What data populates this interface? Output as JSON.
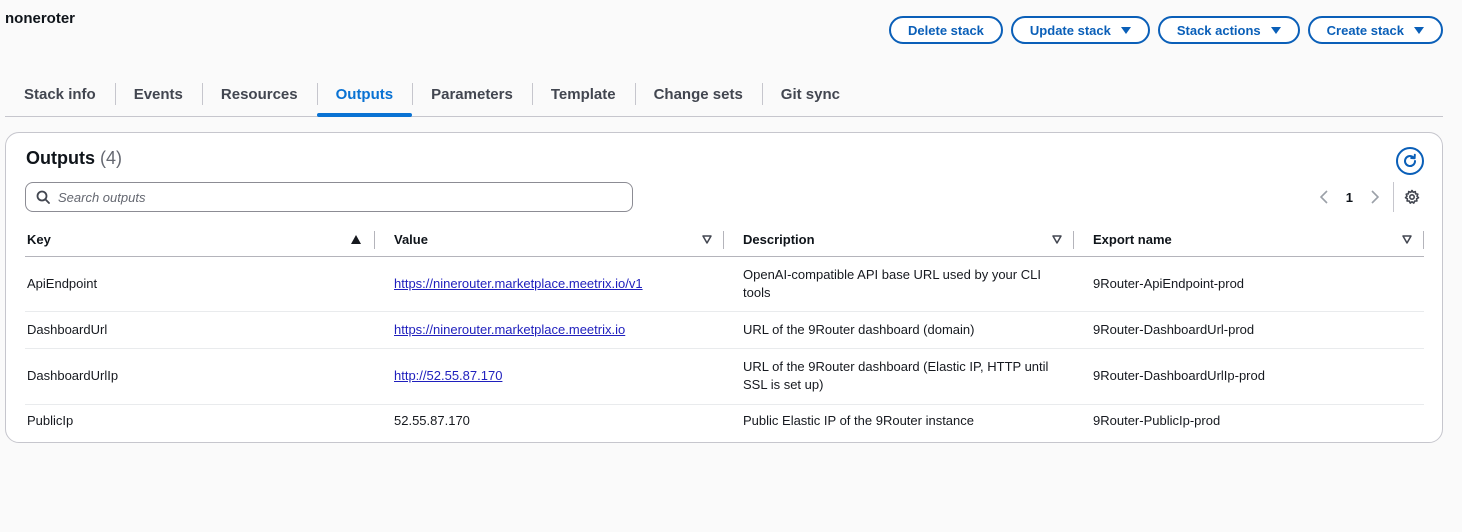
{
  "stack": {
    "title": "noneroter"
  },
  "actions": {
    "delete": "Delete stack",
    "update": "Update stack",
    "stack_actions": "Stack actions",
    "create": "Create stack"
  },
  "tabs": [
    {
      "label": "Stack info"
    },
    {
      "label": "Events"
    },
    {
      "label": "Resources"
    },
    {
      "label": "Outputs",
      "active": true
    },
    {
      "label": "Parameters"
    },
    {
      "label": "Template"
    },
    {
      "label": "Change sets"
    },
    {
      "label": "Git sync"
    }
  ],
  "outputs": {
    "title": "Outputs",
    "count": "(4)",
    "search_placeholder": "Search outputs",
    "page": "1",
    "columns": {
      "key": "Key",
      "value": "Value",
      "description": "Description",
      "export_name": "Export name"
    },
    "rows": [
      {
        "key": "ApiEndpoint",
        "value": "https://ninerouter.marketplace.meetrix.io/v1",
        "value_is_link": true,
        "description": "OpenAI-compatible API base URL used by your CLI tools",
        "export_name": "9Router-ApiEndpoint-prod"
      },
      {
        "key": "DashboardUrl",
        "value": "https://ninerouter.marketplace.meetrix.io",
        "value_is_link": true,
        "description": "URL of the 9Router dashboard (domain)",
        "export_name": "9Router-DashboardUrl-prod"
      },
      {
        "key": "DashboardUrlIp",
        "value": "http://52.55.87.170",
        "value_is_link": true,
        "description": "URL of the 9Router dashboard (Elastic IP, HTTP until SSL is set up)",
        "export_name": "9Router-DashboardUrlIp-prod"
      },
      {
        "key": "PublicIp",
        "value": "52.55.87.170",
        "value_is_link": false,
        "description": "Public Elastic IP of the 9Router instance",
        "export_name": "9Router-PublicIp-prod"
      }
    ]
  },
  "colors": {
    "accent": "#0972d3",
    "button": "#0a5fb8",
    "link": "#1f1fbd"
  }
}
